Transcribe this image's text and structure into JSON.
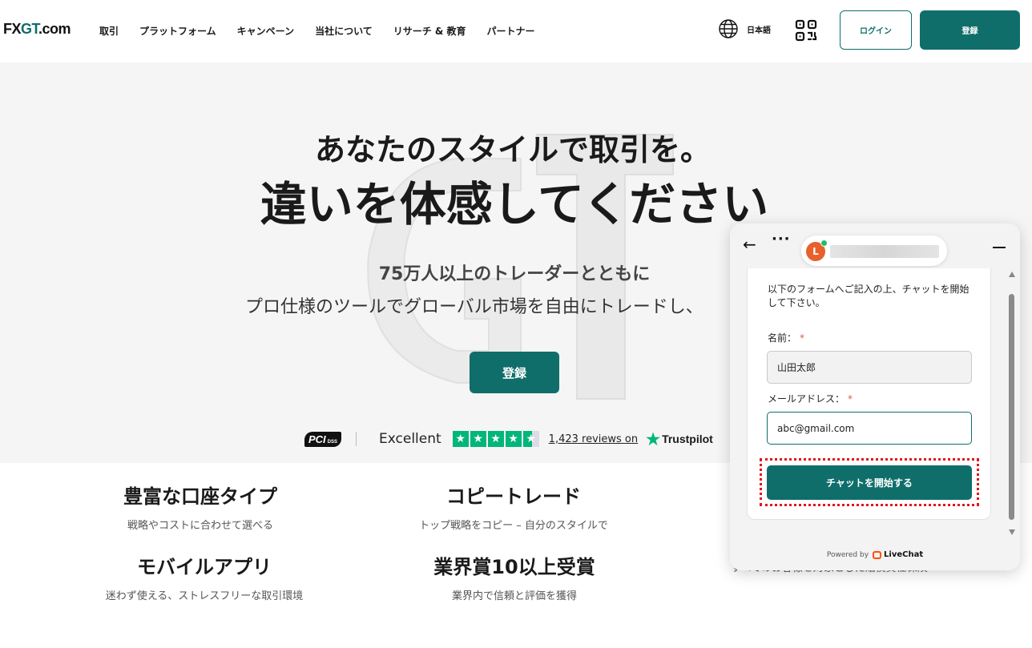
{
  "header": {
    "logo_prefix": "FX",
    "logo_gt": "GT",
    "logo_suffix": ".com",
    "nav": [
      "取引",
      "プラットフォーム",
      "キャンペーン",
      "当社について",
      "リサーチ & 教育",
      "パートナー"
    ],
    "language": "日本語",
    "login_label": "ログイン",
    "register_label": "登録",
    "icons": {
      "language": "globe-icon",
      "qr": "qr-code-icon"
    }
  },
  "hero": {
    "title_line1": "あなたのスタイルで取引を。",
    "title_line2": "違いを体感してください",
    "sub_line1": "75万人以上のトレーダーとともに",
    "sub_line2": "プロ仕様のツールでグローバル市場を自由にトレードし、",
    "cta_label": "登録",
    "trust": {
      "pci_label": "PCI",
      "pci_small": "DSS",
      "rating_word": "Excellent",
      "stars": 4.5,
      "reviews_text": "1,423 reviews on",
      "trustpilot_label": "Trustpilot"
    }
  },
  "features": [
    {
      "title": "豊富な口座タイプ",
      "desc": "戦略やコストに合わせて選べる"
    },
    {
      "title": "コピートレード",
      "desc": "トップ戦略をコピー – 自分のスタイルで"
    },
    {
      "title": "モバイルアプリ",
      "desc": "迷わず使える、ストレスフリーな取引環境"
    },
    {
      "title": "業界賞10以上受賞",
      "desc": "業界内で信頼と評価を獲得"
    },
    {
      "title": "",
      "desc": "すべてのお客様を対象とした賠償責任保険"
    }
  ],
  "chat": {
    "agent_initial": "L",
    "intro": "以下のフォームへご記入の上、チャットを開始して下さい。",
    "name_label": "名前：",
    "name_value": "山田太郎",
    "email_label": "メールアドレス：",
    "email_value": "abc@gmail.com",
    "required_mark": "*",
    "start_label": "チャットを開始する",
    "powered_by": "Powered by",
    "provider": "LiveChat",
    "highlight_color": "#e0151b"
  },
  "colors": {
    "brand": "#0f6e6a",
    "trustpilot": "#00b67a"
  }
}
